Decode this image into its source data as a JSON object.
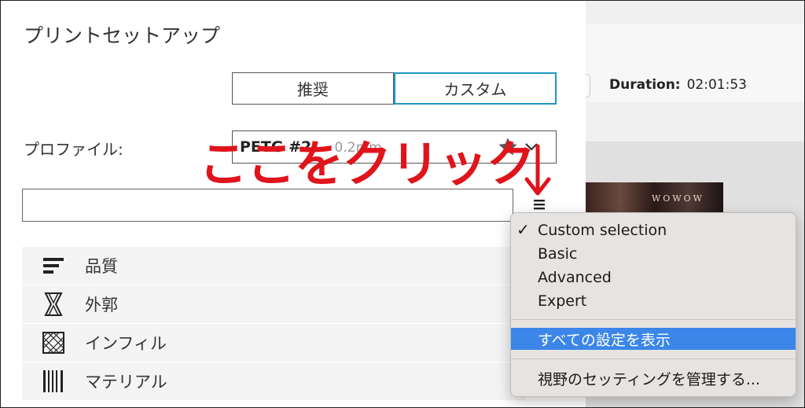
{
  "window": {
    "title": "プリントセットアップ"
  },
  "mode_tabs": {
    "recommended": "推奨",
    "custom": "カスタム",
    "active": "custom"
  },
  "profile": {
    "label": "プロファイル:",
    "name": "PETG #2",
    "sub": "- 0.2mm"
  },
  "search": {
    "placeholder": ""
  },
  "categories": [
    {
      "label": "品質",
      "icon": "quality-icon"
    },
    {
      "label": "外郭",
      "icon": "shell-icon"
    },
    {
      "label": "インフィル",
      "icon": "infill-icon"
    },
    {
      "label": "マテリアル",
      "icon": "material-icon"
    }
  ],
  "annotation": {
    "text": "ここをクリック",
    "arrow": "↓",
    "color": "#e0141b"
  },
  "menu": {
    "items": [
      {
        "label": "Custom selection",
        "checked": true
      },
      {
        "label": "Basic"
      },
      {
        "label": "Advanced"
      },
      {
        "label": "Expert"
      }
    ],
    "show_all": "すべての設定を表示",
    "manage": "視野のセッティングを管理する..."
  },
  "background": {
    "duration_label": "Duration:",
    "duration_value": "02:01:53",
    "thumb_text": "WOWOW"
  },
  "colors": {
    "accent": "#1d97c4",
    "menu_highlight": "#3b86e8",
    "annotation": "#e0141b"
  }
}
